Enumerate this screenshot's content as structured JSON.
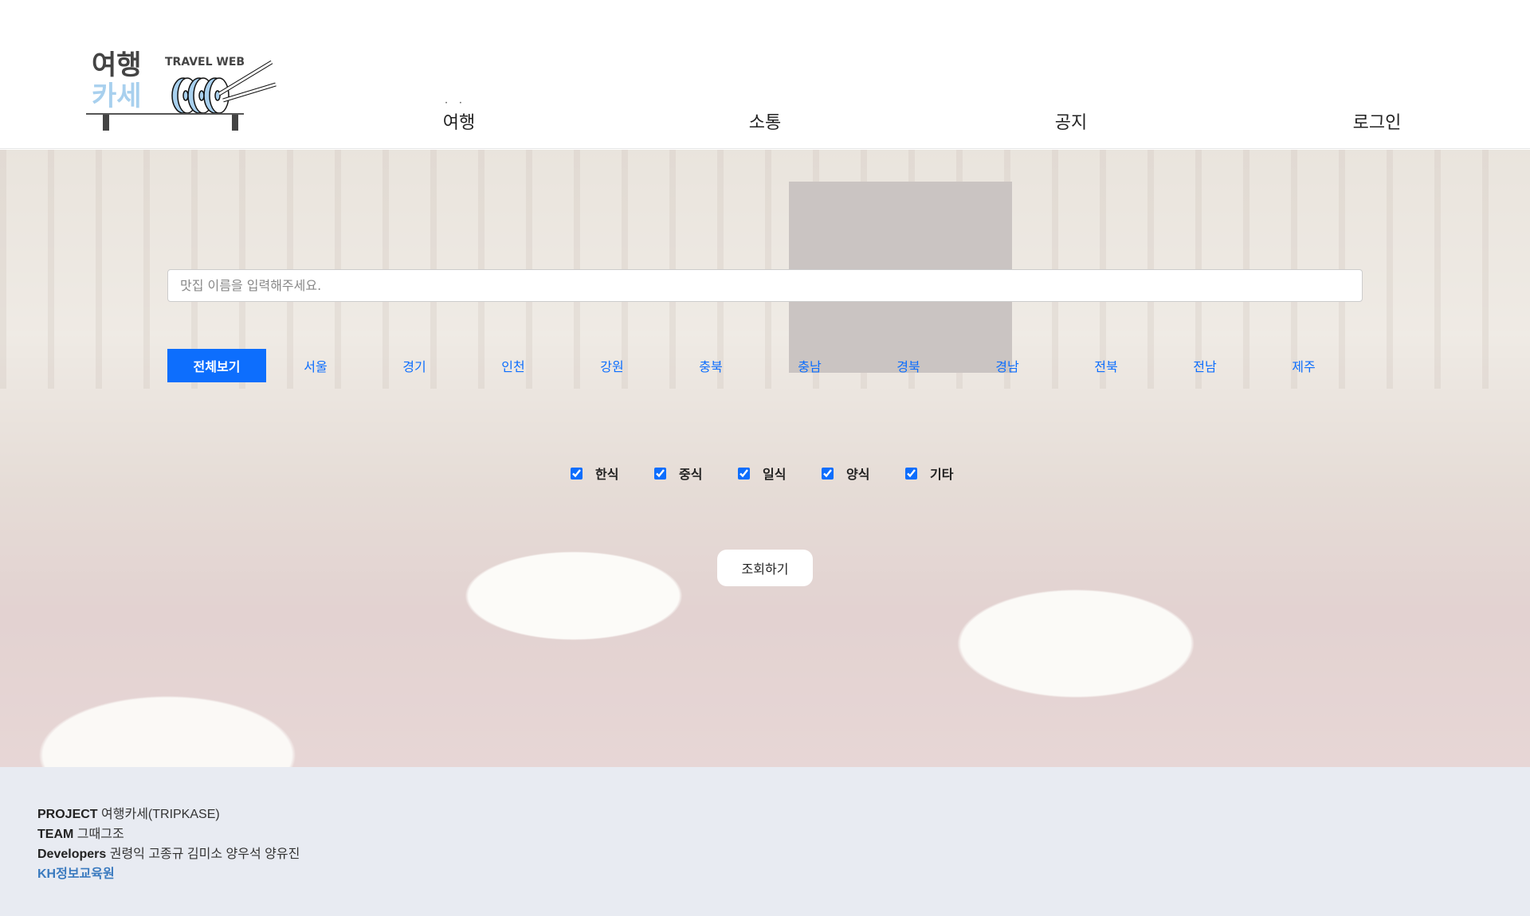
{
  "logo": {
    "title_top": "여행",
    "title_bottom": "카세",
    "subtitle": "TRAVEL WEB",
    "colors": {
      "dark": "#444444",
      "blue": "#a8d0ee"
    }
  },
  "nav": [
    {
      "label": "여행"
    },
    {
      "label": "소통"
    },
    {
      "label": "공지"
    },
    {
      "label": "로그인"
    }
  ],
  "search": {
    "placeholder": "맛집 이름을 입력해주세요.",
    "value": ""
  },
  "regions": [
    {
      "label": "전체보기",
      "active": true
    },
    {
      "label": "서울"
    },
    {
      "label": "경기"
    },
    {
      "label": "인천"
    },
    {
      "label": "강원"
    },
    {
      "label": "충북"
    },
    {
      "label": "충남"
    },
    {
      "label": "경북"
    },
    {
      "label": "경남"
    },
    {
      "label": "전북"
    },
    {
      "label": "전남"
    },
    {
      "label": "제주"
    }
  ],
  "categories": [
    {
      "label": "한식",
      "checked": true
    },
    {
      "label": "중식",
      "checked": true
    },
    {
      "label": "일식",
      "checked": true
    },
    {
      "label": "양식",
      "checked": true
    },
    {
      "label": "기타",
      "checked": true
    }
  ],
  "submit_label": "조회하기",
  "footer": {
    "project_key": "PROJECT",
    "project_val": "여행카세(TRIPKASE)",
    "team_key": "TEAM",
    "team_val": "그때그조",
    "dev_key": "Developers",
    "dev_val": "권령익 고종규 김미소 양우석 양유진",
    "org": "KH정보교육원"
  },
  "colors": {
    "accent": "#0d6efd",
    "footer_bg": "#e8ebf2",
    "org": "#3a7abf"
  }
}
